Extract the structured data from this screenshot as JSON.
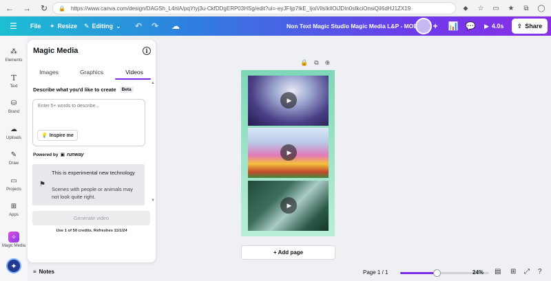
{
  "browser": {
    "url": "https://www.canva.com/design/DAGSh_L4nlA/pqYtyj3u-CkfDDgERP03HSg/edit?ui=-eyJFIjp7IkE_IjoiVilsIklIOiJDIn0sIkciOnsiQiI6dHJ1ZX19"
  },
  "header": {
    "menu_label": "File",
    "resize_label": "Resize",
    "editing_label": "Editing",
    "design_title": "Non Text Magic Studio Magic Media L&P - MOBILE",
    "timer_label": "4.0s",
    "share_label": "Share"
  },
  "rail": {
    "items": [
      {
        "label": "Elements"
      },
      {
        "label": "Text"
      },
      {
        "label": "Brand"
      },
      {
        "label": "Uploads"
      },
      {
        "label": "Draw"
      },
      {
        "label": "Projects"
      },
      {
        "label": "Apps"
      },
      {
        "label": "Magic Media"
      }
    ]
  },
  "panel": {
    "title": "Magic Media",
    "tabs": [
      "Images",
      "Graphics",
      "Videos"
    ],
    "active_tab": "Videos",
    "describe_label": "Describe what you'd like to create",
    "beta_label": "Beta",
    "prompt_placeholder": "Enter 5+ words to describe...",
    "inspire_label": "Inspire me",
    "powered_label": "Powered by",
    "powered_brand": "runway",
    "notice_title": "This is experimental new technology",
    "notice_body": "Scenes with people or animals may not look quite right.",
    "generate_label": "Generate video",
    "credits_label": "Use 1 of 50 credits. Refreshes 11/1/24"
  },
  "canvas": {
    "add_page_label": "+ Add page"
  },
  "bottom": {
    "notes_label": "Notes",
    "page_label": "Page 1 / 1",
    "zoom_label": "24%",
    "zoom_value": 0.24
  },
  "colors": {
    "accent": "#7d2ae8",
    "header_start": "#1dbfd2",
    "header_end": "#8a2fe6"
  }
}
